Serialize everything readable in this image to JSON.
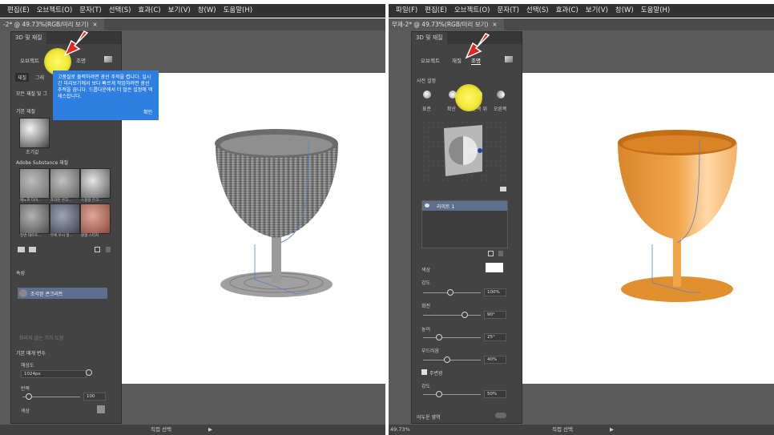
{
  "left": {
    "menu": [
      "편집(E)",
      "오브젝트(O)",
      "문자(T)",
      "선택(S)",
      "효과(C)",
      "보기(V)",
      "창(W)",
      "도움말(H)"
    ],
    "doc_tab": "-2* @ 49.73%(RGB/미리 보기)",
    "doc_tab_close": "×",
    "panel_title": "3D 및 재질",
    "tabs": [
      "오브젝트",
      "재질",
      "조명"
    ],
    "active_tab": "재질",
    "sub_tabs": [
      "재질",
      "그래"
    ],
    "section_all": "모든 재질 및 그",
    "section_basic": "기본 재질",
    "basic_material_name": "조기값",
    "section_adobe": "Adobe Substance 재질",
    "materials": [
      "캐노피 다이...",
      "조각된 콘크...",
      "스정형 은크...",
      "전면 데르츠...",
      "부록 우시 정...",
      "원형 스티치"
    ],
    "section_props": "속성",
    "prop_item": "조각된 콘크리트",
    "hidden_props": "화려지 않는 기가 도형",
    "section_params": "기본 매개 변수",
    "resolution_label": "해상도",
    "resolution_value": "1024px",
    "repeat_label": "반복",
    "repeat_value": "100",
    "color_label": "색상",
    "tooltip": {
      "text": "고품질로 출력하려면 광선 추적을 켭니다. 실시간 미리보기에서 보다 빠르게 작업하려면 광선 추적을 끕니다. 드롭다운에서 더 많은 설정에 액세스합니다.",
      "button": "확인"
    },
    "status": "직접 선택"
  },
  "right": {
    "menu": [
      "파일(F)",
      "편집(E)",
      "오브젝트(O)",
      "문자(T)",
      "선택(S)",
      "효과(C)",
      "보기(V)",
      "창(W)",
      "도움말(H)"
    ],
    "doc_tab": "무제-2* @ 49.73%(RGB/미리 보기)",
    "doc_tab_close": "×",
    "panel_title": "3D 및 재질",
    "tabs": [
      "오브젝트",
      "재질",
      "조명"
    ],
    "active_tab": "조명",
    "presets_label": "사전 설정",
    "presets": [
      "표준",
      "확산",
      "오른쪽 위",
      "오른쪽"
    ],
    "lights_header": "라이트 1",
    "color_label": "색상",
    "color_value": "#ffffff",
    "sliders": [
      {
        "label": "강도",
        "value": "100%",
        "pos": 0.45
      },
      {
        "label": "회전",
        "value": "90°",
        "pos": 0.7
      },
      {
        "label": "높이",
        "value": "25°",
        "pos": 0.25
      },
      {
        "label": "부드러움",
        "value": "40%",
        "pos": 0.4
      }
    ],
    "ambient_label": "주변광",
    "ambient_intensity_label": "강도",
    "ambient_intensity_value": "50%",
    "ambient_pos": 0.25,
    "shadow_label": "어두운 영역",
    "zoom": "49.73%",
    "status": "직접 선택"
  },
  "colors": {
    "goblet_gray": "#8e8e8e",
    "goblet_orange": "#e89a3a",
    "tooltip": "#2f7fe0",
    "highlight": "#f1e836",
    "arrow": "#e8231f"
  }
}
